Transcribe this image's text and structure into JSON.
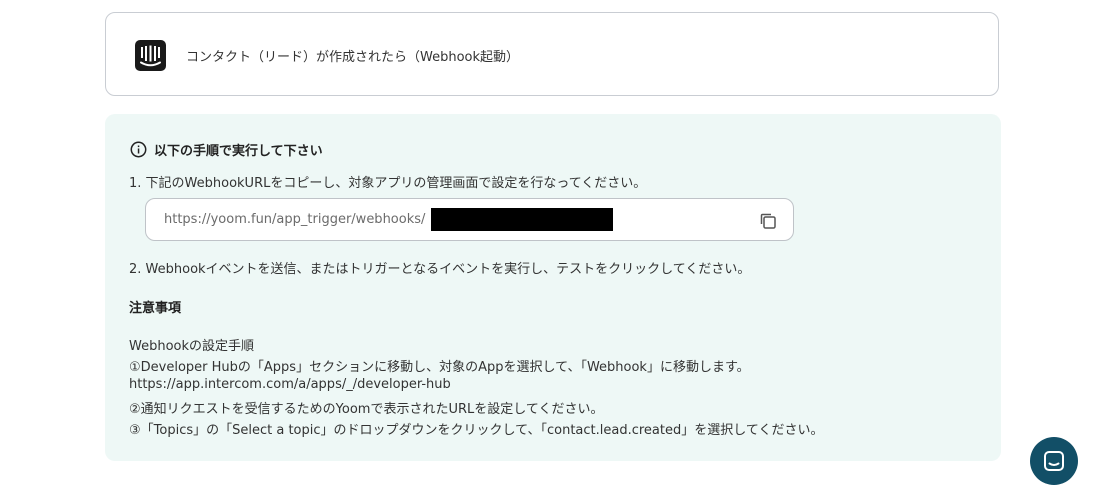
{
  "trigger": {
    "app_icon": "intercom-logo-icon",
    "title": "コンタクト（リード）が作成されたら（Webhook起動）"
  },
  "instructions": {
    "heading": "以下の手順で実行して下さい",
    "step1": "1. 下記のWebhookURLをコピーし、対象アプリの管理画面で設定を行なってください。",
    "url_value": "https://yoom.fun/app_trigger/webhooks/",
    "step2": "2. Webhookイベントを送信、またはトリガーとなるイベントを実行し、テストをクリックしてください。",
    "notes_title": "注意事項",
    "notes_lines": [
      "Webhookの設定手順",
      "①Developer Hubの「Apps」セクションに移動し、対象のAppを選択して、「Webhook」に移動します。",
      "https://app.intercom.com/a/apps/_/developer-hub",
      "②通知リクエストを受信するためのYoomで表示されたURLを設定してください。",
      "③「Topics」の「Select a topic」のドロップダウンをクリックして、「contact.lead.created」を選択してください。"
    ]
  },
  "colors": {
    "panel_bg": "#eef8f6",
    "chat_button": "#124f67"
  }
}
